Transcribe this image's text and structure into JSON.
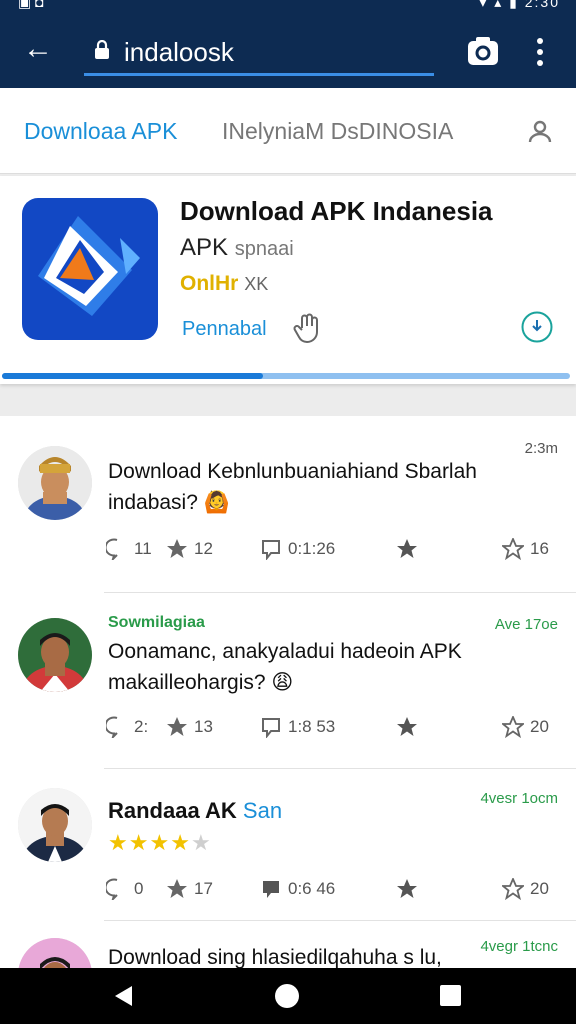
{
  "status_bar": {
    "left_icons": "▣ ◘",
    "right_text": "▾ ▴ ▮ 2:30"
  },
  "address_bar": {
    "url": "indaloosk"
  },
  "tabs": {
    "primary": "Downloaa APK",
    "secondary": "INelyniaM DsDINOSIA"
  },
  "app": {
    "title": "Download APK Indanesia",
    "subtitle": "APK",
    "subtitle_light": "spnaai",
    "rating": "OnlHr",
    "rating_gray": "XK",
    "install_label": "Pennabal",
    "progress": 0.46
  },
  "posts": [
    {
      "time": "2:3m",
      "text": "Download Kebnlunbuaniahiand Sbarlah indabasi? 🙆",
      "actions": {
        "comments": "11",
        "likes": "12",
        "replies": "0:1:26",
        "stars": "16"
      }
    },
    {
      "name": "Sowmilagiaa",
      "time": "Ave 17oe",
      "text": "Oonamanc, anakyaladui hadeoin APK makailleohargis? 😩",
      "actions": {
        "comments": "2:",
        "likes": "13",
        "replies": "1:8 53",
        "stars": "20"
      }
    },
    {
      "name": "Randaaa AK",
      "name_accent": "San",
      "time": "4vesr 1ocm",
      "rating": 4,
      "actions": {
        "comments": "0",
        "likes": "17",
        "replies": "0:6 46",
        "stars": "20"
      }
    },
    {
      "time": "4vegr 1tcnc",
      "text": "Download sing hlasiedilqahuha s lu,"
    }
  ],
  "colors": {
    "bar": "#0d2b52",
    "accent": "#1a8fd8",
    "green": "#2a9b4a",
    "star": "#f2c200"
  }
}
